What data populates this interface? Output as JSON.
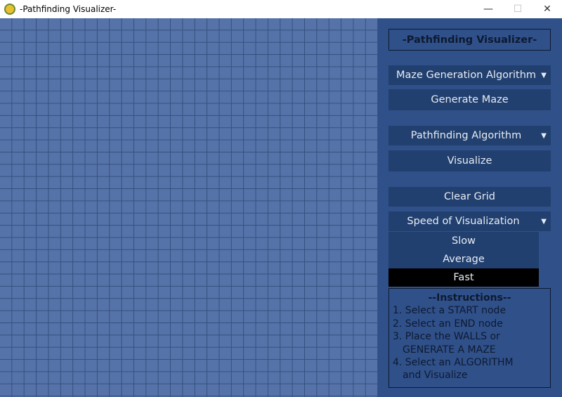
{
  "window": {
    "title": "-Pathfinding Visualizer-",
    "minimize": "—",
    "maximize": "☐",
    "close": "✕"
  },
  "panel": {
    "title": "-Pathfinding Visualizer-",
    "maze_dropdown": "Maze Generation Algorithm",
    "generate_button": "Generate Maze",
    "path_dropdown": "Pathfinding Algorithm",
    "visualize_button": "Visualize",
    "clear_button": "Clear Grid",
    "speed_dropdown": "Speed of Visualization",
    "speed_options": [
      "Slow",
      "Average",
      "Fast"
    ],
    "highlighted_option": "Fast",
    "arrow": "▼",
    "instructions": {
      "heading": "--Instructions--",
      "lines": [
        "1.  Select a START node",
        "2. Select an END node",
        "3. Place the WALLS or",
        "GENERATE A MAZE",
        "4. Select an ALGORITHM",
        "and Visualize"
      ]
    }
  },
  "colors": {
    "grid": "#5673a9",
    "grid_lines": "#34507f",
    "panel": "#30508a",
    "button": "#21406f",
    "highlight": "#000000"
  }
}
